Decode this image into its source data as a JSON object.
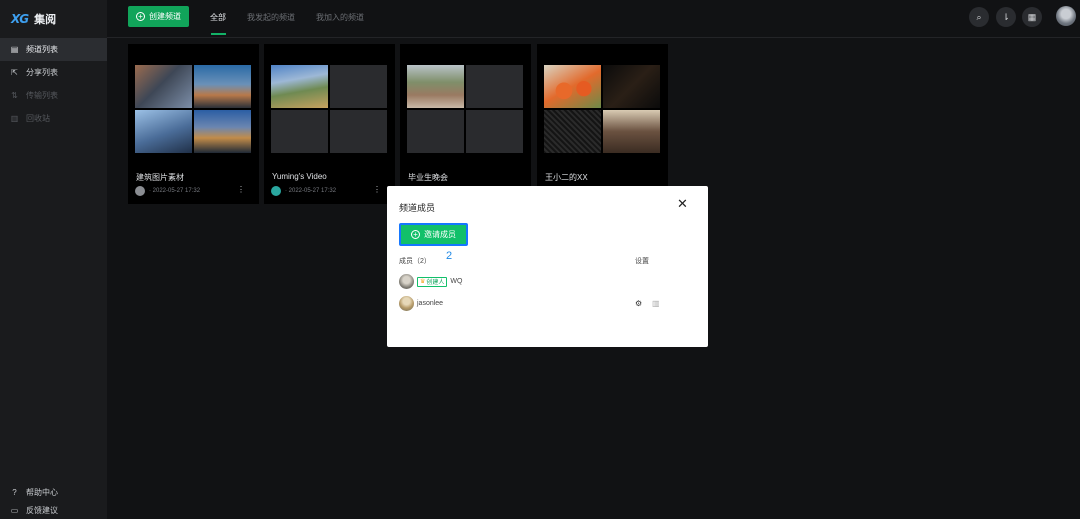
{
  "app": {
    "logo_mark": "XG",
    "name": "集阅"
  },
  "sidebar": {
    "items": [
      {
        "label": "频道列表",
        "icon": "grid-icon",
        "state": "active"
      },
      {
        "label": "分享列表",
        "icon": "share-icon",
        "state": "normal"
      },
      {
        "label": "传输列表",
        "icon": "transfer-icon",
        "state": "disabled"
      },
      {
        "label": "回收站",
        "icon": "trash-icon",
        "state": "disabled"
      }
    ],
    "bottom": [
      {
        "label": "帮助中心",
        "icon": "help-icon"
      },
      {
        "label": "反馈建议",
        "icon": "feedback-icon"
      }
    ]
  },
  "topbar": {
    "create_label": "创建频道",
    "tabs": [
      {
        "label": "全部",
        "active": true
      },
      {
        "label": "我发起的频道",
        "active": false
      },
      {
        "label": "我加入的频道",
        "active": false
      }
    ],
    "tools": [
      "search-icon",
      "sort-icon",
      "qr-icon"
    ]
  },
  "channels": [
    {
      "title": "建筑图片素材",
      "date": "· 2022-05-27 17:32",
      "avatar_color": "#8a8d92"
    },
    {
      "title": "Yuming's Video",
      "date": "· 2022-05-27 17:32",
      "avatar_color": "#2aa7a0"
    },
    {
      "title": "毕业生晚会",
      "date": "",
      "avatar_color": ""
    },
    {
      "title": "王小二的XX",
      "date": "",
      "avatar_color": ""
    }
  ],
  "dialog": {
    "title": "频道成员",
    "close_glyph": "✕",
    "invite_label": "邀请成员",
    "annotation": "2",
    "members_header": "成员（2）",
    "settings_header": "设置",
    "owner_badge": "创建人",
    "members": [
      {
        "name": "WQ",
        "owner": true
      },
      {
        "name": "jasonlee",
        "owner": false
      }
    ]
  },
  "colors": {
    "accent": "#11a45a",
    "focus": "#1677ff",
    "background": "#111214"
  }
}
